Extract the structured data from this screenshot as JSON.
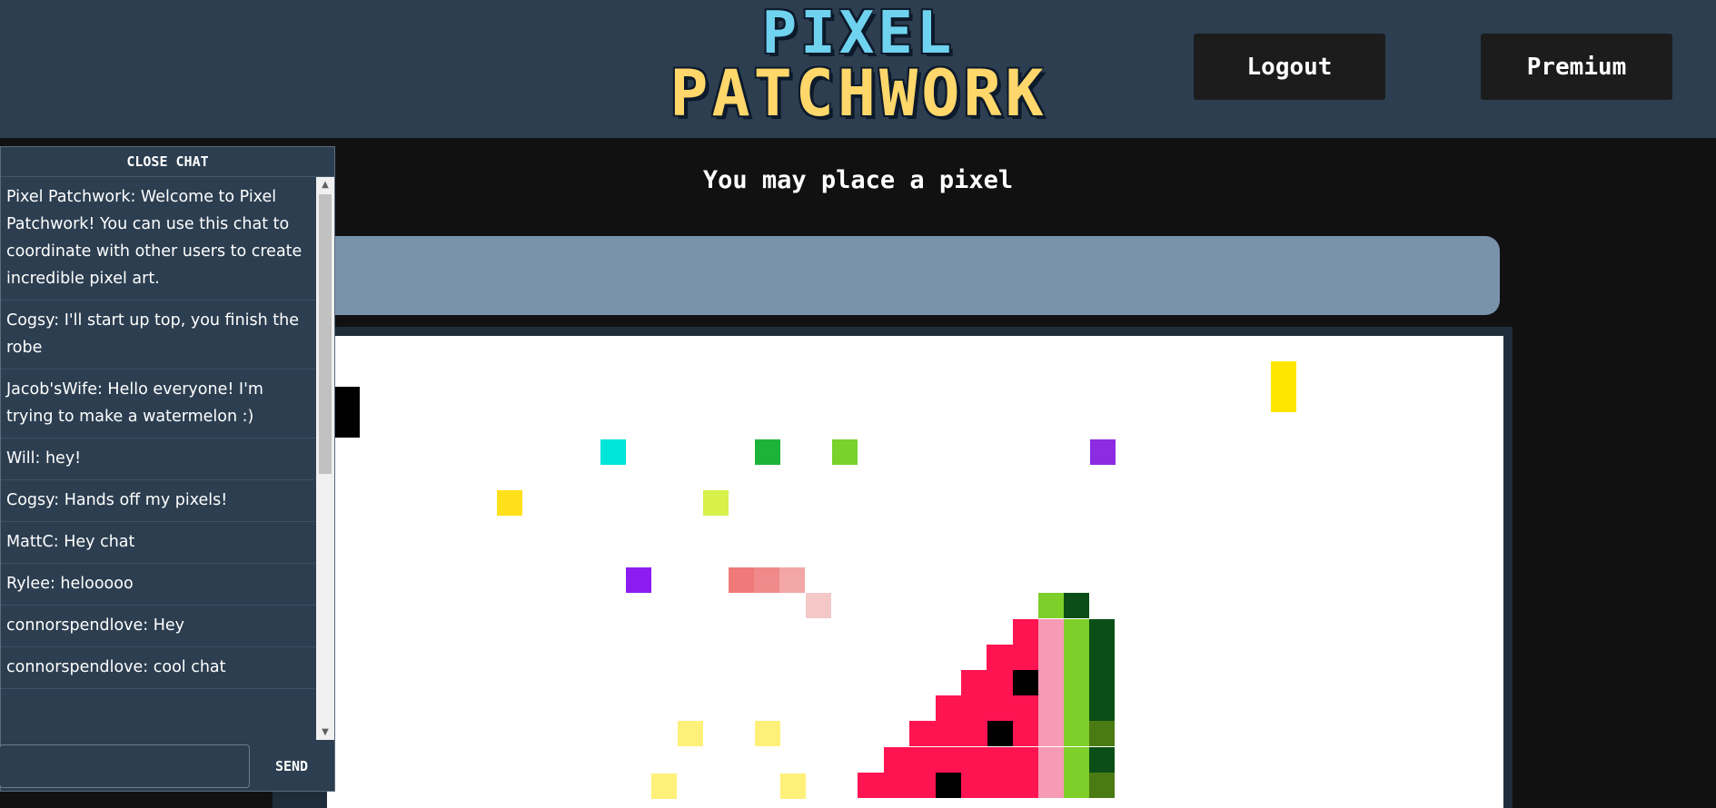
{
  "header": {
    "logo_line1": "PIXEL",
    "logo_line2": "PATCHWORK",
    "logout_label": "Logout",
    "premium_label": "Premium"
  },
  "status_text": "You may place a pixel",
  "chat": {
    "close_label": "CLOSE CHAT",
    "send_label": "SEND",
    "input_value": "",
    "messages": [
      "Pixel Patchwork: Welcome to Pixel Patchwork! You can use this chat to coordinate with other users to create incredible pixel art.",
      "Cogsy: I'll start up top, you finish the robe",
      "Jacob'sWife: Hello everyone! I'm trying to make a watermelon :)",
      "Will: hey!",
      "Cogsy: Hands off my pixels!",
      "MattC: Hey chat",
      "Rylee: helooooo",
      "connorspendlove: Hey",
      "connorspendlove: cool chat"
    ]
  },
  "colors": {
    "header_bg": "#2c3e50",
    "page_bg": "#111111",
    "palette_bg": "#7a93ad",
    "canvas_bg": "#ffffff",
    "button_bg": "#1c1c1c"
  }
}
